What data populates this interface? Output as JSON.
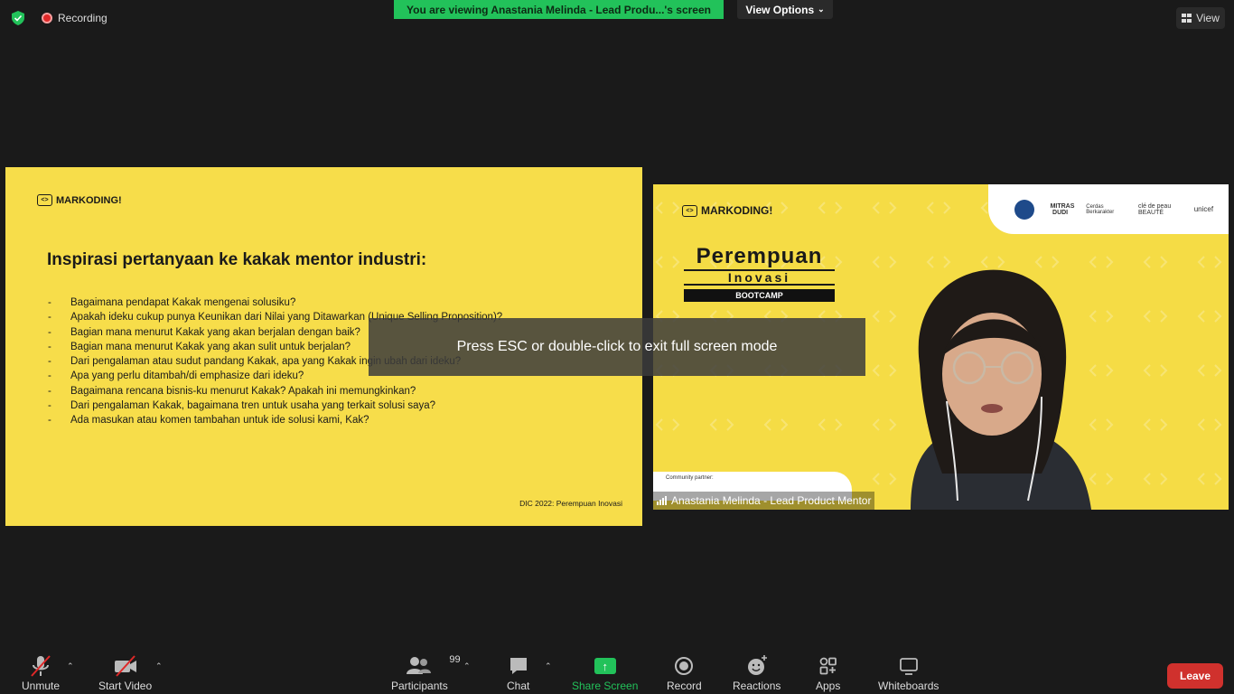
{
  "top": {
    "recording_label": "Recording",
    "viewing_banner": "You are viewing Anastania Melinda - Lead Produ...'s screen",
    "view_options_label": "View Options",
    "view_label": "View"
  },
  "slide": {
    "logo_text": "MARKODING!",
    "title": "Inspirasi pertanyaan ke kakak mentor industri:",
    "items": [
      "Bagaimana pendapat Kakak mengenai solusiku?",
      "Apakah ideku cukup punya Keunikan dari Nilai yang Ditawarkan (Unique Selling Proposition)?",
      "Bagian mana menurut Kakak yang akan berjalan dengan baik?",
      "Bagian mana menurut Kakak yang akan sulit untuk berjalan?",
      "Dari pengalaman atau sudut pandang Kakak, apa yang Kakak ingin ubah dari ideku?",
      "Apa yang perlu ditambah/di emphasize dari ideku?",
      "Bagaimana rencana bisnis-ku menurut Kakak? Apakah ini memungkinkan?",
      "Dari pengalaman Kakak, bagaimana tren untuk usaha yang terkait solusi saya?",
      "Ada masukan atau komen tambahan untuk ide solusi kami, Kak?"
    ],
    "footer": "DIC 2022: Perempuan Inovasi"
  },
  "video": {
    "logo_text": "MARKODING!",
    "brand_line1": "Perempuan",
    "brand_line2": "Inovasi",
    "brand_line3": "BOOTCAMP",
    "partners": [
      "MITRAS DUDI",
      "Cerdas Berkarakter",
      "clé de peau BEAUTÉ",
      "unicef"
    ],
    "community_label": "Community partner:",
    "participant_name": "Anastania Melinda - Lead Product Mentor"
  },
  "esc_message": "Press ESC or double-click to exit full screen mode",
  "toolbar": {
    "unmute": "Unmute",
    "start_video": "Start Video",
    "participants": "Participants",
    "participant_count": "99",
    "chat": "Chat",
    "share_screen": "Share Screen",
    "record": "Record",
    "reactions": "Reactions",
    "apps": "Apps",
    "whiteboards": "Whiteboards",
    "leave": "Leave"
  },
  "colors": {
    "accent_green": "#22c25a",
    "slide_yellow": "#f7dd4a",
    "leave_red": "#d0312d"
  }
}
